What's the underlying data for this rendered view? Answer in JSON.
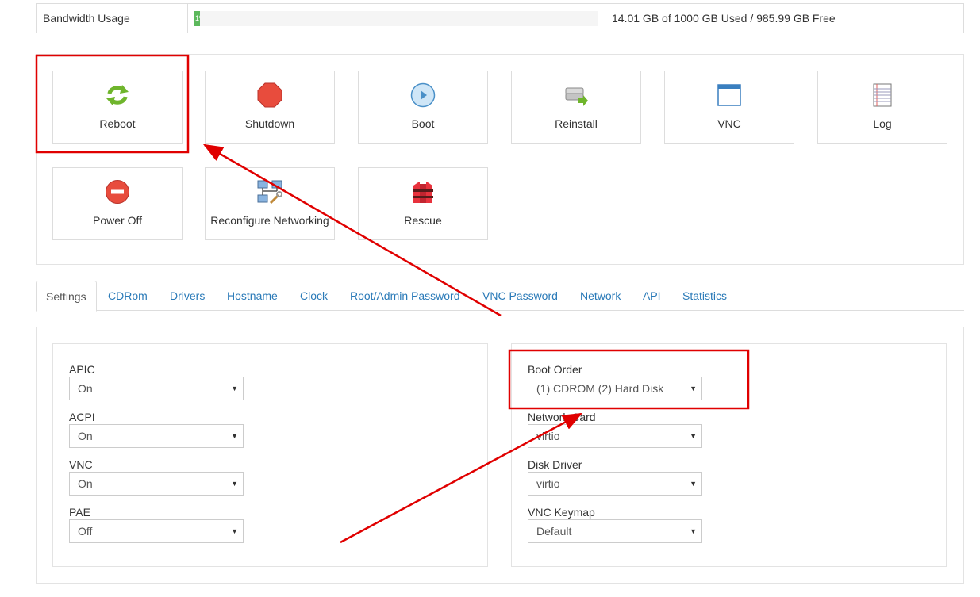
{
  "bandwidth": {
    "label": "Bandwidth Usage",
    "percent_text": "1%",
    "used_fraction": 0.014,
    "value_text": "14.01 GB of 1000 GB Used / 985.99 GB Free"
  },
  "actions": [
    {
      "label": "Reboot",
      "icon": "reboot-icon"
    },
    {
      "label": "Shutdown",
      "icon": "shutdown-icon"
    },
    {
      "label": "Boot",
      "icon": "boot-icon"
    },
    {
      "label": "Reinstall",
      "icon": "reinstall-icon"
    },
    {
      "label": "VNC",
      "icon": "vnc-icon"
    },
    {
      "label": "Log",
      "icon": "log-icon"
    },
    {
      "label": "Power Off",
      "icon": "power-off-icon"
    },
    {
      "label": "Reconfigure Networking",
      "icon": "network-icon"
    },
    {
      "label": "Rescue",
      "icon": "rescue-icon"
    }
  ],
  "tabs": [
    "Settings",
    "CDRom",
    "Drivers",
    "Hostname",
    "Clock",
    "Root/Admin Password",
    "VNC Password",
    "Network",
    "API",
    "Statistics"
  ],
  "active_tab": "Settings",
  "settings": {
    "left": [
      {
        "label": "APIC",
        "value": "On"
      },
      {
        "label": "ACPI",
        "value": "On"
      },
      {
        "label": "VNC",
        "value": "On"
      },
      {
        "label": "PAE",
        "value": "Off"
      }
    ],
    "right": [
      {
        "label": "Boot Order",
        "value": "(1) CDROM (2) Hard Disk"
      },
      {
        "label": "Network Card",
        "value": "virtio"
      },
      {
        "label": "Disk Driver",
        "value": "virtio"
      },
      {
        "label": "VNC Keymap",
        "value": "Default"
      }
    ]
  },
  "caret": "▼",
  "colors": {
    "link": "#2a7ab8",
    "annotation": "#e00000",
    "progress": "#5cb85c"
  }
}
